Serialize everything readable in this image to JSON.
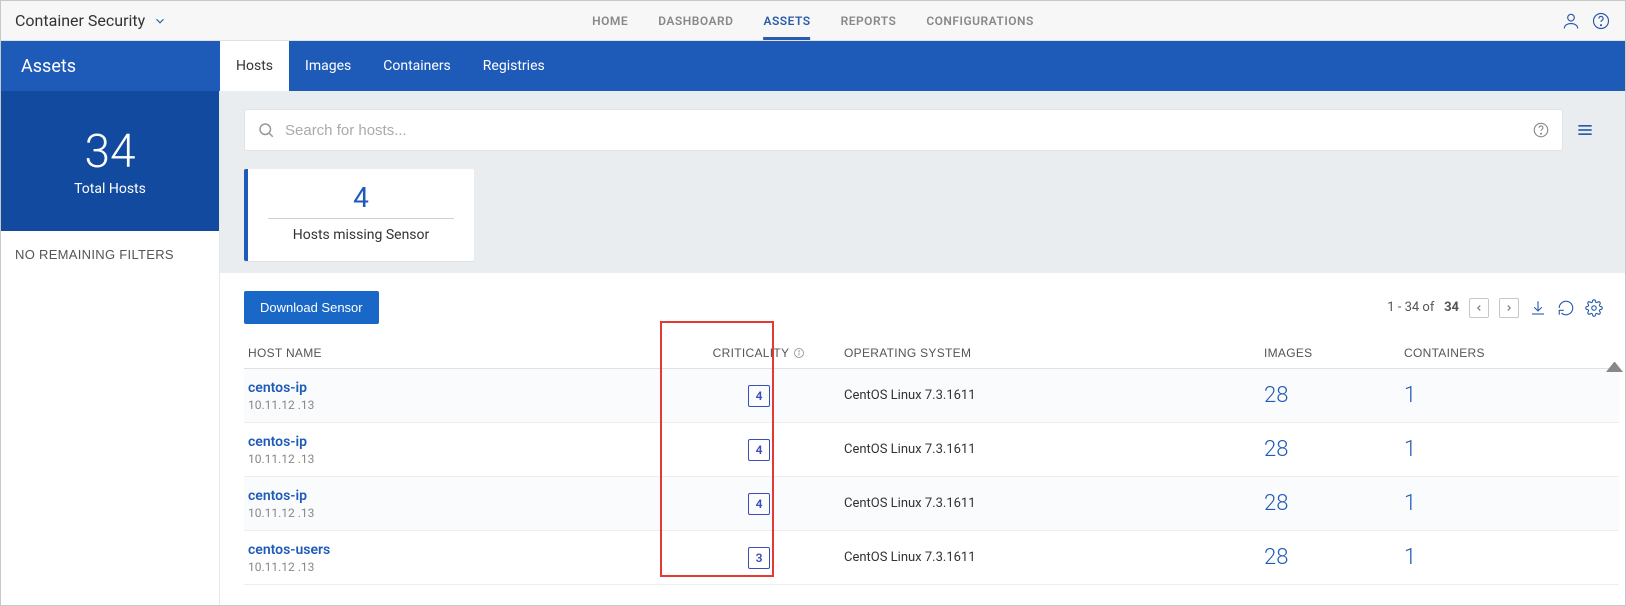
{
  "app": {
    "name": "Container Security"
  },
  "topnav": {
    "home": "HOME",
    "dashboard": "DASHBOARD",
    "assets": "ASSETS",
    "reports": "REPORTS",
    "configurations": "CONFIGURATIONS"
  },
  "pageTitle": "Assets",
  "tabs": {
    "hosts": "Hosts",
    "images": "Images",
    "containers": "Containers",
    "registries": "Registries"
  },
  "sidebar": {
    "total_count": "34",
    "total_label": "Total Hosts",
    "no_filters": "NO REMAINING FILTERS"
  },
  "search": {
    "placeholder": "Search for hosts..."
  },
  "card": {
    "count": "4",
    "label": "Hosts missing Sensor"
  },
  "toolbar": {
    "download_sensor": "Download Sensor",
    "range": "1 - 34 of",
    "total": "34"
  },
  "columns": {
    "host": "HOST NAME",
    "criticality": "CRITICALITY",
    "os": "OPERATING SYSTEM",
    "images": "IMAGES",
    "containers": "CONTAINERS"
  },
  "rows": [
    {
      "name": "centos-ip",
      "ip": "10.11.12 .13",
      "criticality": "4",
      "os": "CentOS Linux 7.3.1611",
      "images": "28",
      "containers": "1"
    },
    {
      "name": "centos-ip",
      "ip": "10.11.12 .13",
      "criticality": "4",
      "os": "CentOS Linux 7.3.1611",
      "images": "28",
      "containers": "1"
    },
    {
      "name": "centos-ip",
      "ip": "10.11.12 .13",
      "criticality": "4",
      "os": "CentOS Linux 7.3.1611",
      "images": "28",
      "containers": "1"
    },
    {
      "name": "centos-users",
      "ip": "10.11.12 .13",
      "criticality": "3",
      "os": "CentOS Linux 7.3.1611",
      "images": "28",
      "containers": "1"
    }
  ]
}
